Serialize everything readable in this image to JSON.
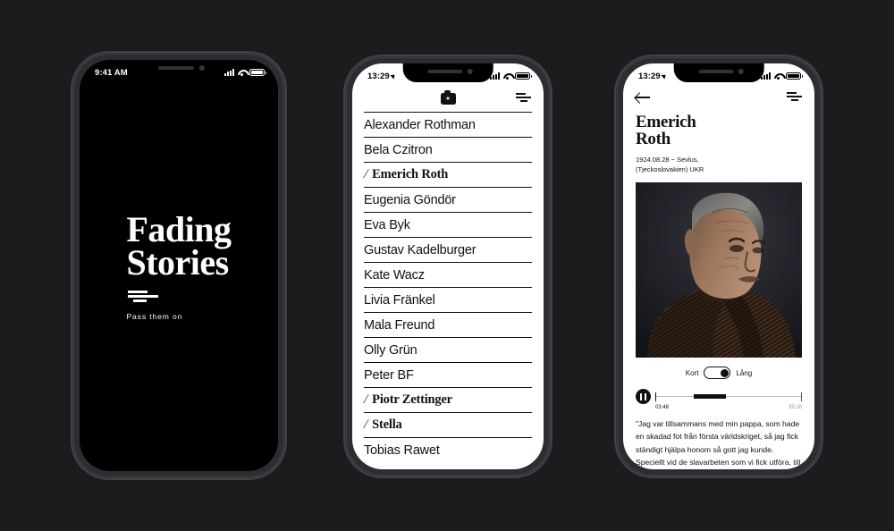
{
  "background_color": "#1c1c1e",
  "phones": {
    "splash": {
      "status": {
        "time": "9:41 AM"
      },
      "logo_line1": "Fading",
      "logo_line2": "Stories",
      "tagline": "Pass them on"
    },
    "list": {
      "status": {
        "time": "13:29"
      },
      "appbar": {
        "camera_icon": "camera-icon",
        "filter_icon": "filter-icon"
      },
      "names": [
        {
          "name": "Alexander Rothman",
          "highlighted": false
        },
        {
          "name": "Bela Czitron",
          "highlighted": false
        },
        {
          "name": "Emerich Roth",
          "highlighted": true
        },
        {
          "name": "Eugenia Göndör",
          "highlighted": false
        },
        {
          "name": "Eva Byk",
          "highlighted": false
        },
        {
          "name": "Gustav Kadelburger",
          "highlighted": false
        },
        {
          "name": "Kate Wacz",
          "highlighted": false
        },
        {
          "name": "Livia Fränkel",
          "highlighted": false
        },
        {
          "name": "Mala Freund",
          "highlighted": false
        },
        {
          "name": "Olly Grün",
          "highlighted": false
        },
        {
          "name": "Peter BF",
          "highlighted": false
        },
        {
          "name": "Piotr Zettinger",
          "highlighted": true
        },
        {
          "name": "Stella",
          "highlighted": true
        },
        {
          "name": "Tobias Rawet",
          "highlighted": false
        }
      ]
    },
    "detail": {
      "status": {
        "time": "13:29"
      },
      "back_label": "Back",
      "title_line1": "Emerich",
      "title_line2": "Roth",
      "meta_line1": "1924.08.28 ~ Sevlus,",
      "meta_line2": "(Tjeckoslovakien) UKR",
      "portrait_alt": "Portrait of elderly man in brown striped shirt",
      "toggle": {
        "left_label": "Kort",
        "right_label": "Lång",
        "state": "right"
      },
      "player": {
        "current_time": "03:48",
        "total_time": "35:16",
        "playing": true
      },
      "quote": "\"Jag var tillsammans med min pappa, som hade en skadad fot från första världskriget, så jag fick ständigt hjälpa honom så gott jag kunde. Speciellt vid de slavarbeten som vi fick utföra, till exempel"
    }
  }
}
